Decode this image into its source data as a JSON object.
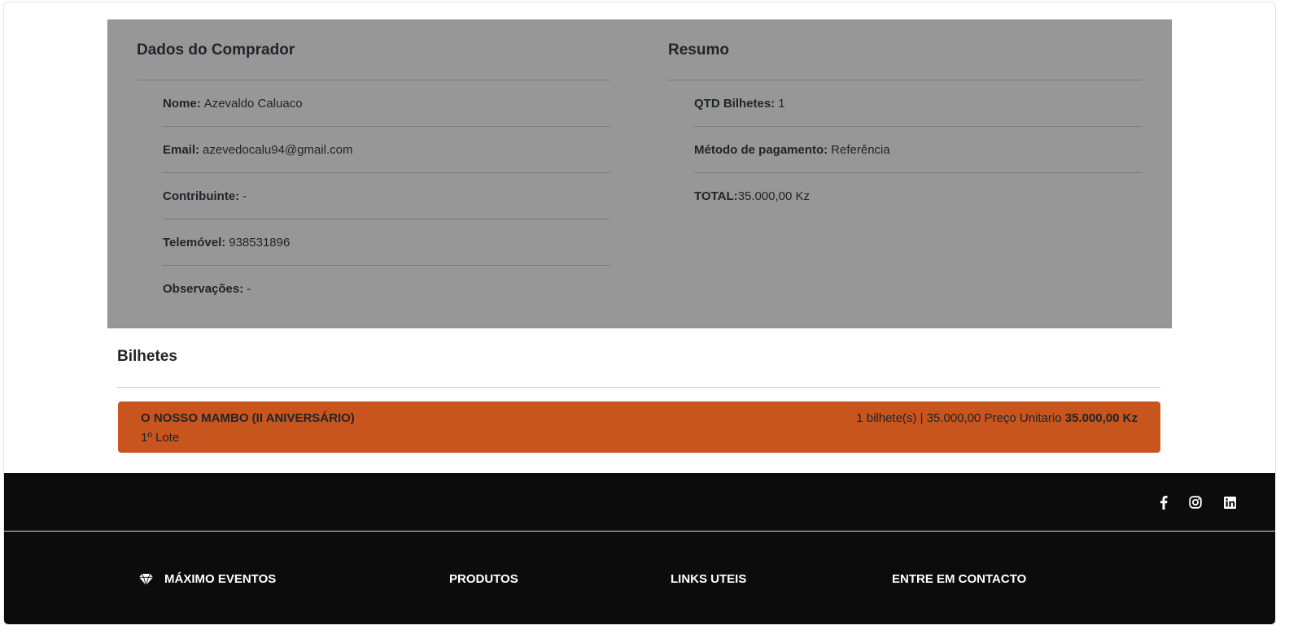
{
  "buyer": {
    "title": "Dados do Comprador",
    "fields": [
      {
        "label": "Nome:",
        "value": "Azevaldo Caluaco"
      },
      {
        "label": "Email:",
        "value": "azevedocalu94@gmail.com"
      },
      {
        "label": "Contribuinte:",
        "value": "-"
      },
      {
        "label": "Telemóvel:",
        "value": "938531896"
      },
      {
        "label": "Observações:",
        "value": "-"
      }
    ]
  },
  "summary": {
    "title": "Resumo",
    "fields": [
      {
        "label": "QTD Bilhetes:",
        "value": "1"
      },
      {
        "label": "Método de pagamento:",
        "value": "Referência"
      },
      {
        "label": "TOTAL:",
        "value": "35.000,00 Kz"
      }
    ]
  },
  "tickets": {
    "title": "Bilhetes",
    "items": [
      {
        "name": "O NOSSO MAMBO (II ANIVERSÁRIO)",
        "lot": "1º Lote",
        "price_text": "1 bilhete(s) | 35.000,00 Preço Unitario",
        "total": "35.000,00 Kz"
      }
    ]
  },
  "footer": {
    "social_icons": [
      "facebook-icon",
      "instagram-icon",
      "linkedin-icon"
    ],
    "brand": "MÁXIMO EVENTOS",
    "columns": [
      "PRODUTOS",
      "LINKS UTEIS",
      "ENTRE EM CONTACTO"
    ]
  },
  "colors": {
    "panel_bg": "#979797",
    "ticket_bg": "#c8541e",
    "footer_bg": "#0c0c0c"
  }
}
